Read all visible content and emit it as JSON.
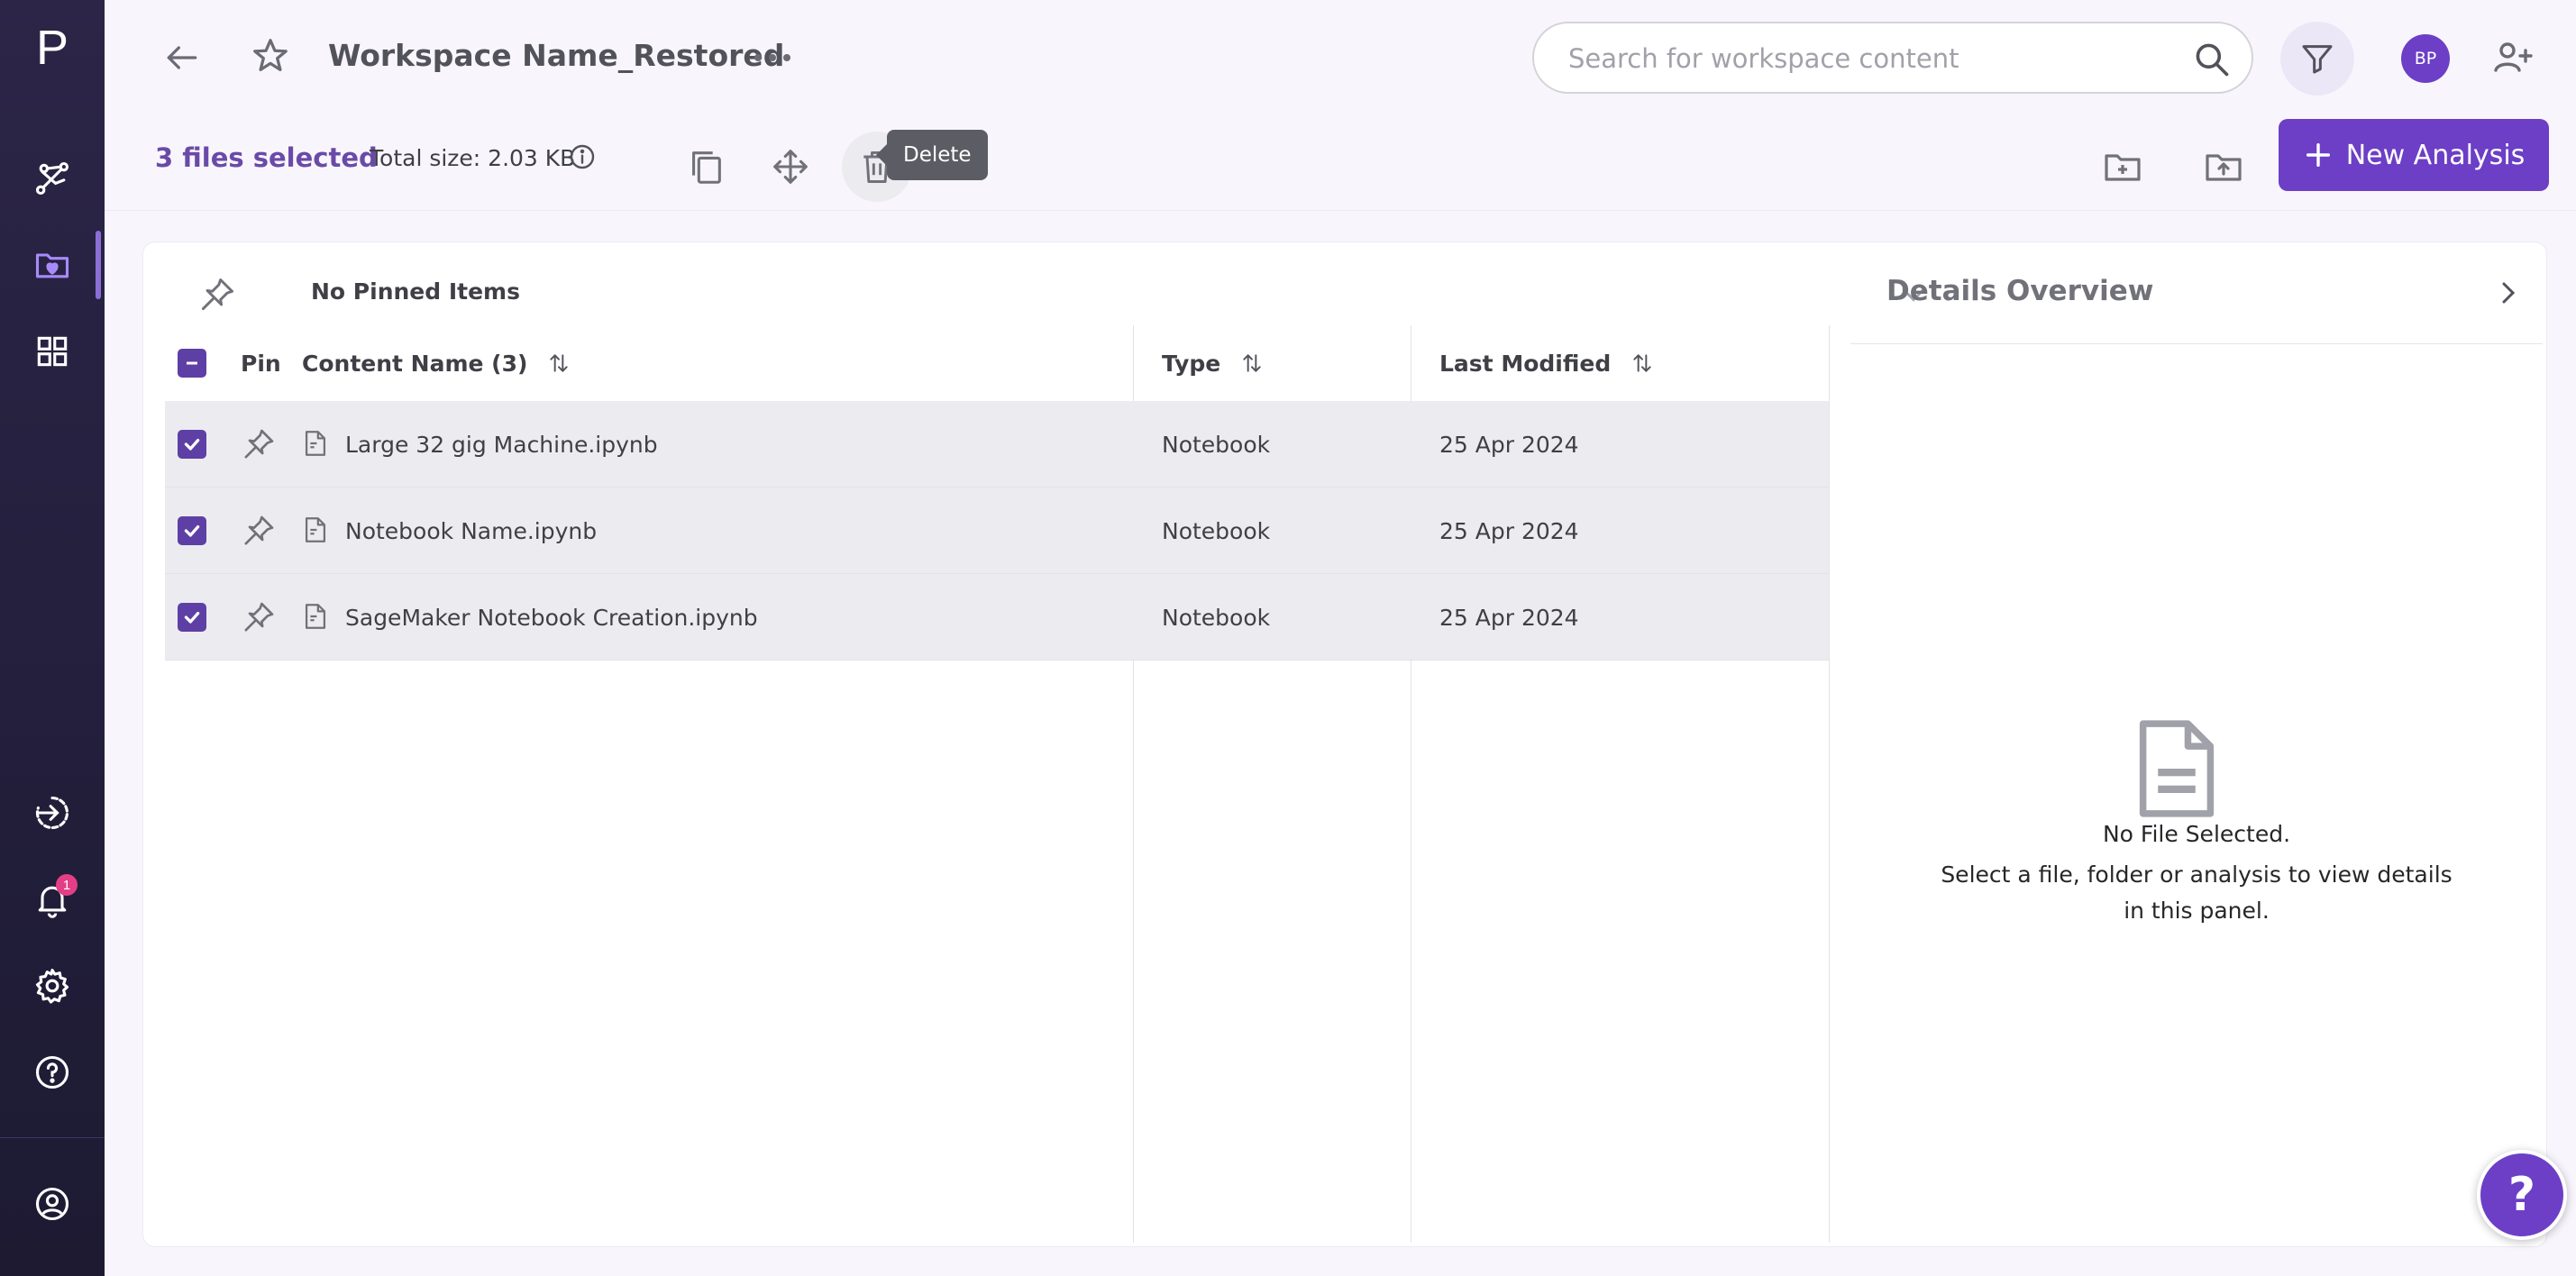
{
  "app": {
    "logo_letter": "P"
  },
  "sidebar": {
    "notification_count": "1"
  },
  "header": {
    "workspace_title": "Workspace Name_Restored",
    "search_placeholder": "Search for workspace content",
    "avatar_initials": "BP"
  },
  "action_bar": {
    "selected_count": "3 files selected",
    "total_size": "Total size: 2.03 KB",
    "tooltip": "Delete",
    "new_analysis_label": "New Analysis"
  },
  "pinned": {
    "label": "No Pinned Items"
  },
  "table": {
    "columns": {
      "pin": "Pin",
      "name": "Content Name (3)",
      "type": "Type",
      "modified": "Last Modified"
    },
    "rows": [
      {
        "name": "Large 32 gig Machine.ipynb",
        "type": "Notebook",
        "modified": "25 Apr 2024"
      },
      {
        "name": "Notebook Name.ipynb",
        "type": "Notebook",
        "modified": "25 Apr 2024"
      },
      {
        "name": "SageMaker Notebook Creation.ipynb",
        "type": "Notebook",
        "modified": "25 Apr 2024"
      }
    ]
  },
  "details": {
    "title": "Details Overview",
    "empty_title": "No File Selected.",
    "empty_desc": "Select a file, folder or analysis to view details in this panel."
  },
  "help": {
    "label": "?"
  },
  "colors": {
    "accent": "#6c3fc6",
    "sidebar": "#231f3c",
    "checkbox": "#5e3fa6",
    "badge": "#e33f86"
  }
}
